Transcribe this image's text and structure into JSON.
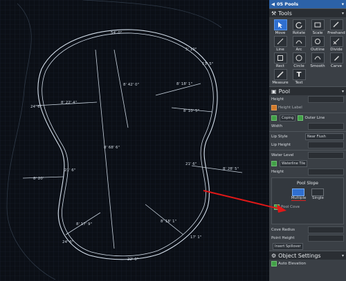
{
  "panel": {
    "title": "05 Pools",
    "tools_section": {
      "label": "Tools",
      "items": [
        {
          "label": "Move",
          "icon": "cursor-icon",
          "active": true
        },
        {
          "label": "Rotate",
          "icon": "rotate-icon"
        },
        {
          "label": "Scale",
          "icon": "scale-icon"
        },
        {
          "label": "Freehand",
          "icon": "freehand-icon"
        },
        {
          "label": "Line",
          "icon": "line-icon"
        },
        {
          "label": "Arc",
          "icon": "arc-icon"
        },
        {
          "label": "Outline",
          "icon": "outline-icon"
        },
        {
          "label": "Divide",
          "icon": "divide-icon"
        },
        {
          "label": "Rect",
          "icon": "rect-icon"
        },
        {
          "label": "Circle",
          "icon": "circle-icon"
        },
        {
          "label": "Smooth",
          "icon": "smooth-icon"
        },
        {
          "label": "Carve",
          "icon": "carve-icon"
        },
        {
          "label": "Measure",
          "icon": "measure-icon"
        },
        {
          "label": "Text",
          "icon": "text-icon"
        }
      ]
    },
    "pool_section": {
      "label": "Pool",
      "height_label": "Height",
      "height_label_toggle": "Height Label",
      "coping_label": "Coping",
      "outer_line_label": "Outer Line",
      "width_label": "Width",
      "lip_style_label": "Lip Style",
      "lip_style_value": "Near Flush",
      "lip_height_label": "Lip Height",
      "water_level_label": "Water Level",
      "waterline_tile_label": "Waterline Tile",
      "height2_label": "Height",
      "pool_slope": {
        "title": "Pool Slope",
        "multiple_label": "Multiple",
        "single_label": "Single"
      },
      "pool_cove_label": "Pool Cove",
      "cove_radius_label": "Cove Radius",
      "point_height_label": "Point Height",
      "insert_spillover_label": "Insert Spillover"
    },
    "object_settings": {
      "label": "Object Settings",
      "auto_elevation_label": "Auto Elevation"
    }
  },
  "drawing": {
    "dimensions": [
      "54' 0\"",
      "5' 10\"",
      "13' 5\"",
      "13' 5\"",
      "24' 6\"",
      "8' 22' 4\"",
      "8' 42' 0\"",
      "8' 68' 6\"",
      "8' 18' 1\"",
      "8' 10' 5\"",
      "21' 6\"",
      "8' 28' 5\"",
      "21' 6\"",
      "8' 20'",
      "8' 17' 9\"",
      "24' 6\"",
      "8' 18' 1\"",
      "17' 1\"",
      "22' 0\""
    ]
  },
  "colors": {
    "canvas_bg": "#0b0f16",
    "grid": "#1b2230",
    "pool_outline": "#d7e2ee",
    "arrow": "#e01818",
    "panel_bg": "#3a3f45",
    "titlebar": "#2c62a8"
  }
}
